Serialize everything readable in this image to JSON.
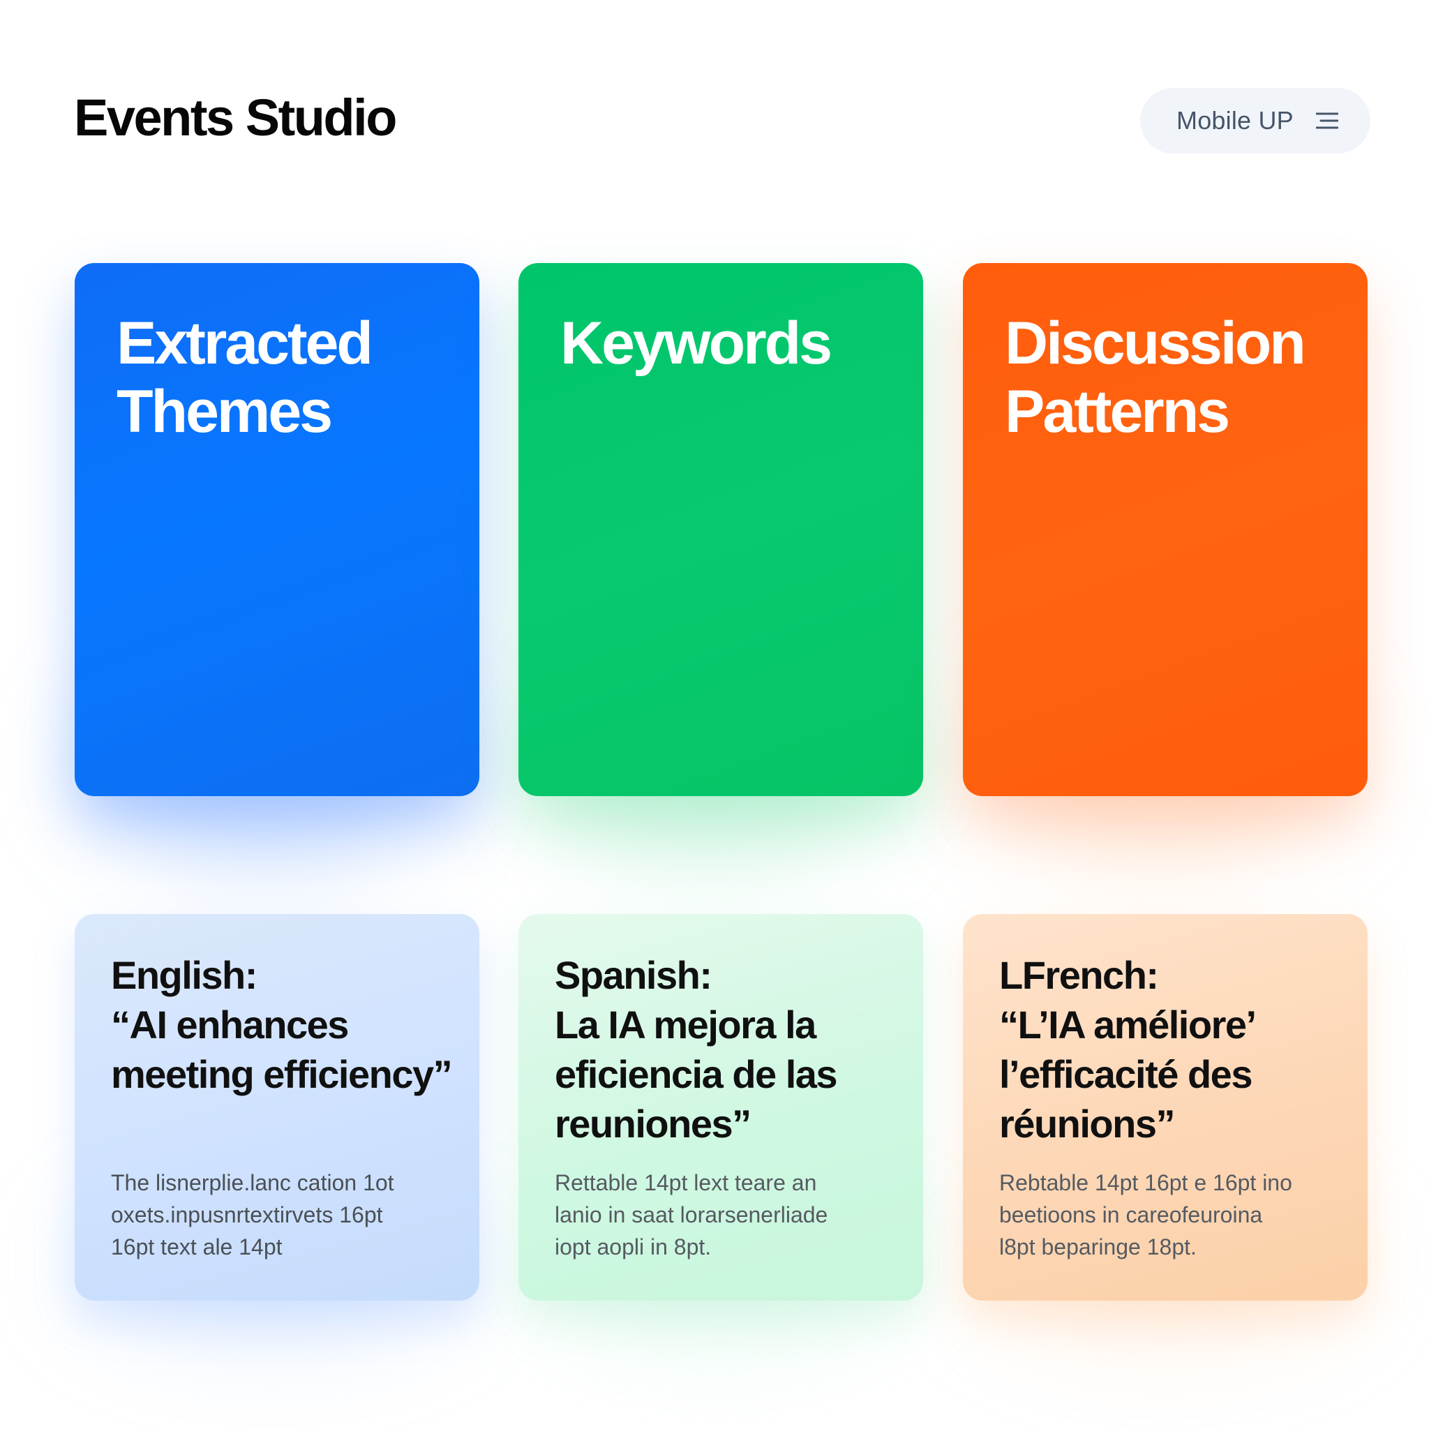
{
  "header": {
    "title": "Events Studio",
    "mode_label": "Mobile UP",
    "mode_icon": "menu-icon"
  },
  "theme_cards": [
    {
      "title": "Extracted\nThemes",
      "color": "#0A74FA"
    },
    {
      "title": "Keywords",
      "color": "#04C86C"
    },
    {
      "title": "Discussion\nPatterns",
      "color": "#FF610E"
    }
  ],
  "quote_cards": [
    {
      "quote": "English:\n“AI enhances\nmeeting efficiency”",
      "body": "The lisnerplie.lanc cation 1ot\noxets.inpusnrtextirvets 16pt\n16pt text ale 14pt",
      "color": "#D4E6FD"
    },
    {
      "quote": "Spanish:\nLa IA mejora la\neficiencia de las\nreuniones”",
      "body": "Rettable 14pt lext teare an\nlanio in saat lorarsenerliade\niopt aopli in 8pt.",
      "color": "#D4F8E4"
    },
    {
      "quote": "LFrench:\n“L’IA améliore’\nl’efficacité des\nréunions”",
      "body": "Rebtable 14pt 16pt e 16pt ino\nbeetioons in careofeuroina\nl8pt beparinge 18pt.",
      "color": "#FDDBBE"
    }
  ]
}
